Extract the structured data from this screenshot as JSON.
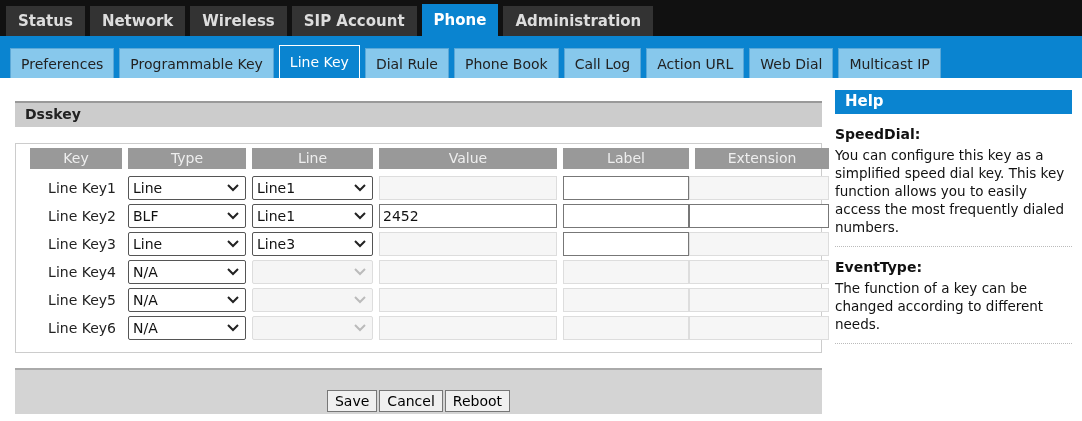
{
  "tabs": [
    {
      "label": "Status",
      "selected": false
    },
    {
      "label": "Network",
      "selected": false
    },
    {
      "label": "Wireless",
      "selected": false
    },
    {
      "label": "SIP Account",
      "selected": false
    },
    {
      "label": "Phone",
      "selected": true
    },
    {
      "label": "Administration",
      "selected": false
    }
  ],
  "subtabs": [
    {
      "label": "Preferences",
      "selected": false
    },
    {
      "label": "Programmable Key",
      "selected": false
    },
    {
      "label": "Line Key",
      "selected": true
    },
    {
      "label": "Dial Rule",
      "selected": false
    },
    {
      "label": "Phone Book",
      "selected": false
    },
    {
      "label": "Call Log",
      "selected": false
    },
    {
      "label": "Action URL",
      "selected": false
    },
    {
      "label": "Web Dial",
      "selected": false
    },
    {
      "label": "Multicast IP",
      "selected": false
    }
  ],
  "section": {
    "title": "Dsskey"
  },
  "table": {
    "columns": [
      "Key",
      "Type",
      "Line",
      "Value",
      "Label",
      "Extension"
    ],
    "rows": [
      {
        "key": "Line Key1",
        "type": "Line",
        "line": "Line1",
        "line_disabled": false,
        "value_disabled": true,
        "label_disabled": false,
        "extension_disabled": true
      },
      {
        "key": "Line Key2",
        "type": "BLF",
        "line": "Line1",
        "line_disabled": false,
        "value": "2452",
        "value_disabled": false,
        "label_disabled": false,
        "extension_disabled": false
      },
      {
        "key": "Line Key3",
        "type": "Line",
        "line": "Line3",
        "line_disabled": false,
        "value_disabled": true,
        "label_disabled": false,
        "extension_disabled": true
      },
      {
        "key": "Line Key4",
        "type": "N/A",
        "line_disabled": true,
        "value_disabled": true,
        "label_disabled": true,
        "extension_disabled": true
      },
      {
        "key": "Line Key5",
        "type": "N/A",
        "line_disabled": true,
        "value_disabled": true,
        "label_disabled": true,
        "extension_disabled": true
      },
      {
        "key": "Line Key6",
        "type": "N/A",
        "line_disabled": true,
        "value_disabled": true,
        "label_disabled": true,
        "extension_disabled": true
      }
    ]
  },
  "buttons": [
    "Save",
    "Cancel",
    "Reboot"
  ],
  "help": {
    "title": "Help",
    "entries": [
      {
        "heading": "SpeedDial:",
        "text": "You can configure this key as a simplified speed dial key. This key function allows you to easily access the most frequently dialed numbers."
      },
      {
        "heading": "EventType:",
        "text": "The function of a key can be changed according to different needs."
      }
    ]
  }
}
